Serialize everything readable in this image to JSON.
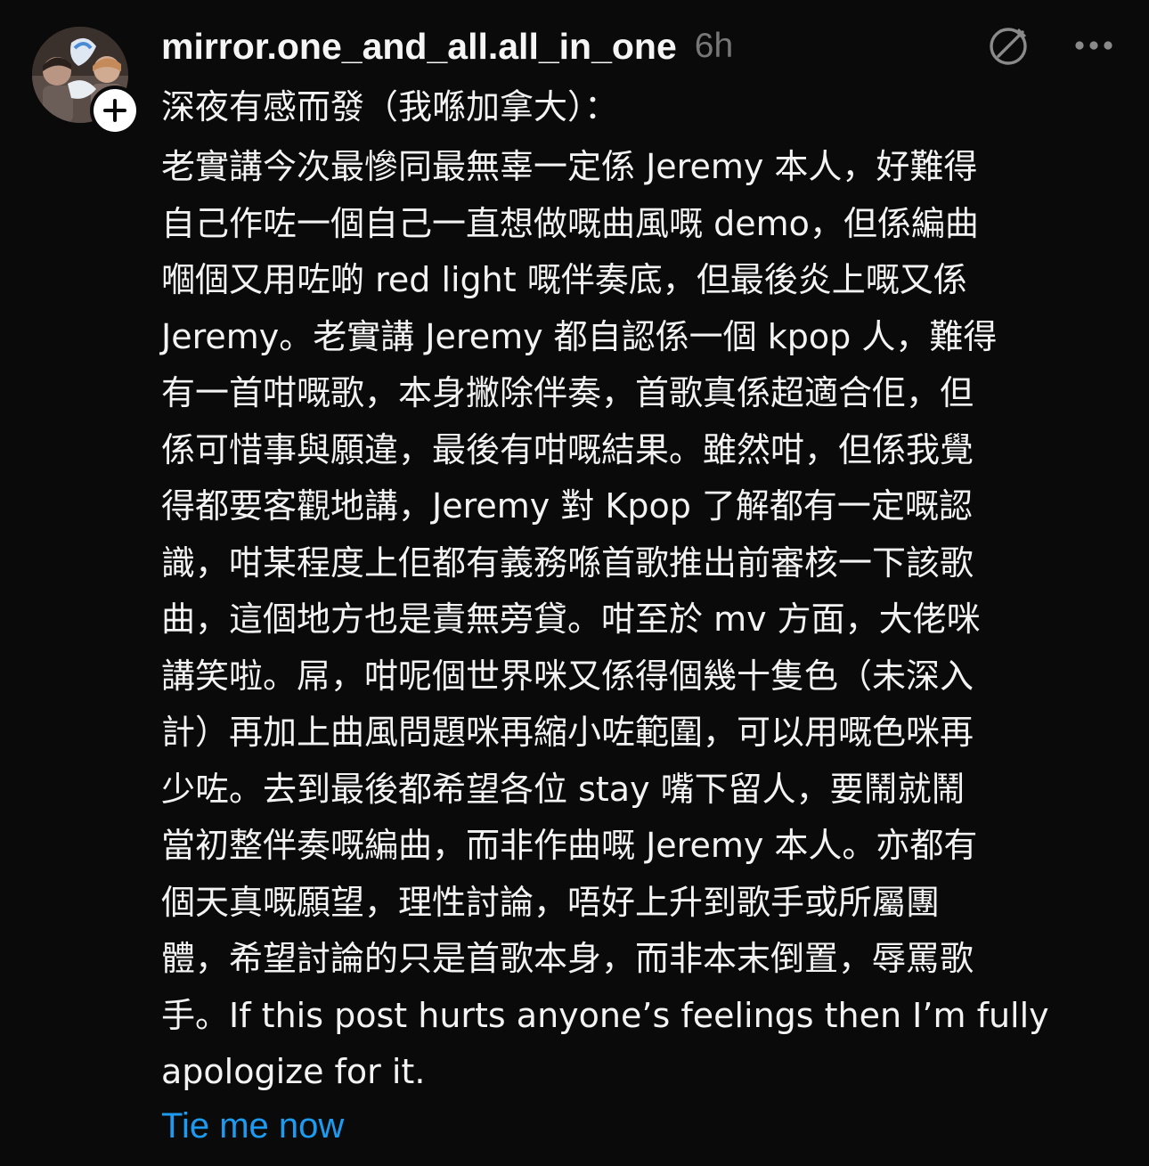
{
  "post": {
    "username": "mirror.one_and_all.all_in_one",
    "timestamp": "6h",
    "subtitle": "深夜有感而發（我喺加拿大）：",
    "body_lines": [
      "老實講今次最慘同最無辜一定係 Jeremy 本人，好難得",
      "自己作咗一個自己一直想做嘅曲風嘅 demo，但係編曲",
      "嗰個又用咗啲 red light 嘅伴奏底，但最後炎上嘅又係",
      " Jeremy。老實講 Jeremy 都自認係一個 kpop 人，難得",
      "有一首咁嘅歌，本身撇除伴奏，首歌真係超適合佢，但",
      "係可惜事與願違，最後有咁嘅結果。雖然咁，但係我覺",
      "得都要客觀地講，Jeremy 對 Kpop 了解都有一定嘅認",
      "識，咁某程度上佢都有義務喺首歌推出前審核一下該歌",
      "曲，這個地方也是責無旁貸。咁至於 mv 方面，大佬咪",
      "講笑啦。屌，咁呢個世界咪又係得個幾十隻色（未深入",
      "計）再加上曲風問題咪再縮小咗範圍，可以用嘅色咪再",
      "少咗。去到最後都希望各位 stay 嘴下留人，要鬧就鬧",
      "當初整伴奏嘅編曲，而非作曲嘅 Jeremy 本人。亦都有",
      "個天真嘅願望，理性討論，唔好上升到歌手或所屬團",
      "體，希望討論的只是首歌本身，而非本末倒置，辱罵歌",
      "手。If this post hurts anyone’s feelings then I’m fully",
      "apologize for it."
    ],
    "translate_label": "Tie me now"
  },
  "icons": {
    "avatar": "avatar-image",
    "follow": "plus-icon",
    "action_1": "slashed-circle-pen-icon",
    "more": "more-horizontal-icon"
  },
  "colors": {
    "background": "#0a0a0a",
    "text": "#f3f3f3",
    "timestamp": "#777777",
    "link": "#1d9bf0"
  }
}
